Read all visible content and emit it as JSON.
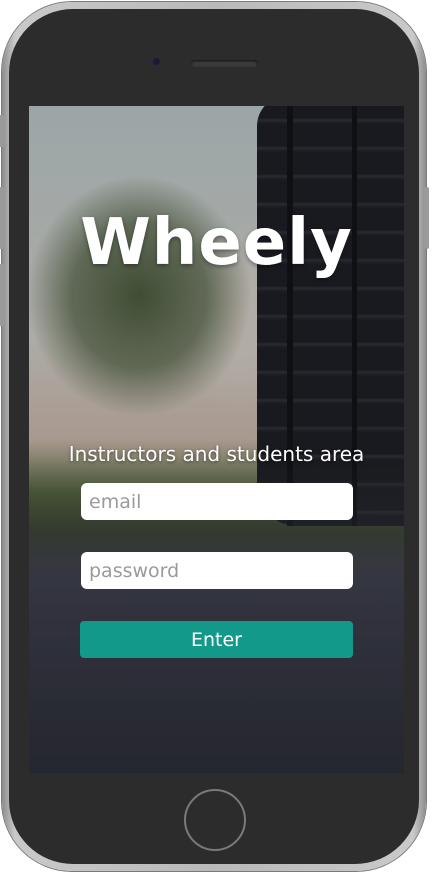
{
  "app": {
    "title": "Wheely",
    "subtitle": "Instructors and students area"
  },
  "login": {
    "email_placeholder": "email",
    "email_value": "",
    "password_placeholder": "password",
    "password_value": "",
    "submit_label": "Enter"
  },
  "colors": {
    "primary_button": "#12998a",
    "title_text": "#ffffff",
    "input_background": "#ffffff"
  }
}
